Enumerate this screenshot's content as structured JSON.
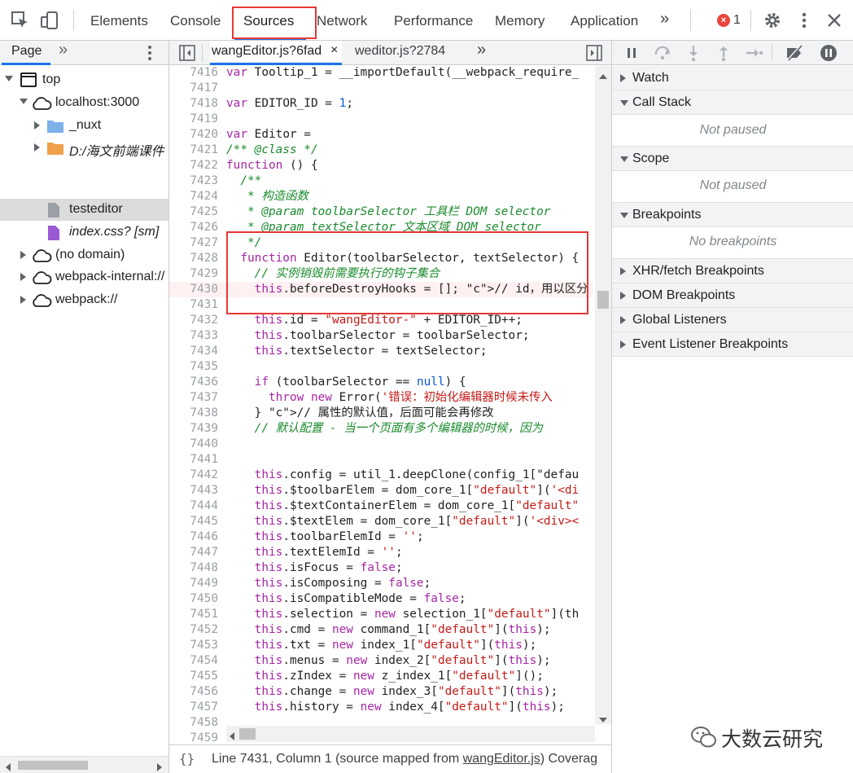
{
  "toolbar": {
    "tabs": [
      "Elements",
      "Console",
      "Sources",
      "Network",
      "Performance",
      "Memory",
      "Application"
    ],
    "active_tab": "Sources",
    "more": "»",
    "error_count": "1",
    "error_badge": "×"
  },
  "navigator": {
    "tab": "Page",
    "more": "»",
    "tree": [
      {
        "label": "top",
        "icon": "frame-icon",
        "arrow": "down"
      },
      {
        "label": "localhost:3000",
        "icon": "cloud-icon",
        "arrow": "down"
      },
      {
        "label": "_nuxt",
        "icon": "folder-icon",
        "arrow": "right"
      },
      {
        "label": "D:/海文前端课件",
        "icon": "folder-icon",
        "arrow": "right"
      },
      {
        "label": "testeditor",
        "icon": "file-icon",
        "arrow": "none"
      },
      {
        "label": "index.css? [sm]",
        "icon": "file-icon",
        "arrow": "none"
      },
      {
        "label": "(no domain)",
        "icon": "cloud-icon",
        "arrow": "right"
      },
      {
        "label": "webpack-internal://",
        "icon": "cloud-icon",
        "arrow": "right"
      },
      {
        "label": "webpack://",
        "icon": "cloud-icon",
        "arrow": "right"
      }
    ]
  },
  "editor": {
    "tabs": [
      {
        "label": "wangEditor.js?6fad",
        "close": "×"
      },
      {
        "label": "weditor.js?2784"
      }
    ],
    "more": "»",
    "lines": [
      {
        "n": "7416",
        "code": "var Tooltip_1 = __importDefault(__webpack_require_"
      },
      {
        "n": "7417",
        "code": ""
      },
      {
        "n": "7418",
        "code": "var EDITOR_ID = 1;"
      },
      {
        "n": "7419",
        "code": ""
      },
      {
        "n": "7420",
        "code": "var Editor ="
      },
      {
        "n": "7421",
        "code": "/** @class */"
      },
      {
        "n": "7422",
        "code": "function () {"
      },
      {
        "n": "7423",
        "code": "  /**"
      },
      {
        "n": "7424",
        "code": "   * 构造函数"
      },
      {
        "n": "7425",
        "code": "   * @param toolbarSelector 工具栏 DOM selector"
      },
      {
        "n": "7426",
        "code": "   * @param textSelector 文本区域 DOM selector"
      },
      {
        "n": "7427",
        "code": "   */"
      },
      {
        "n": "7428",
        "code": "  function Editor(toolbarSelector, textSelector) {"
      },
      {
        "n": "7429",
        "code": "    // 实例销毁前需要执行的钩子集合"
      },
      {
        "n": "7430",
        "code": "    this.beforeDestroyHooks = []; // id，用以区分"
      },
      {
        "n": "7431",
        "code": ""
      },
      {
        "n": "7432",
        "code": "    this.id = \"wangEditor-\" + EDITOR_ID++;"
      },
      {
        "n": "7433",
        "code": "    this.toolbarSelector = toolbarSelector;"
      },
      {
        "n": "7434",
        "code": "    this.textSelector = textSelector;"
      },
      {
        "n": "7435",
        "code": ""
      },
      {
        "n": "7436",
        "code": "    if (toolbarSelector == null) {"
      },
      {
        "n": "7437",
        "code": "      throw new Error('错误：初始化编辑器时候未传入"
      },
      {
        "n": "7438",
        "code": "    } // 属性的默认值，后面可能会再修改"
      },
      {
        "n": "7439",
        "code": "    // 默认配置 - 当一个页面有多个编辑器的时候，因为"
      },
      {
        "n": "7440",
        "code": ""
      },
      {
        "n": "7441",
        "code": ""
      },
      {
        "n": "7442",
        "code": "    this.config = util_1.deepClone(config_1[\"defau"
      },
      {
        "n": "7443",
        "code": "    this.$toolbarElem = dom_core_1[\"default\"]('<di"
      },
      {
        "n": "7444",
        "code": "    this.$textContainerElem = dom_core_1[\"default\""
      },
      {
        "n": "7445",
        "code": "    this.$textElem = dom_core_1[\"default\"]('<div><"
      },
      {
        "n": "7446",
        "code": "    this.toolbarElemId = '';"
      },
      {
        "n": "7447",
        "code": "    this.textElemId = '';"
      },
      {
        "n": "7448",
        "code": "    this.isFocus = false;"
      },
      {
        "n": "7449",
        "code": "    this.isComposing = false;"
      },
      {
        "n": "7450",
        "code": "    this.isCompatibleMode = false;"
      },
      {
        "n": "7451",
        "code": "    this.selection = new selection_1[\"default\"](th"
      },
      {
        "n": "7452",
        "code": "    this.cmd = new command_1[\"default\"](this);"
      },
      {
        "n": "7453",
        "code": "    this.txt = new index_1[\"default\"](this);"
      },
      {
        "n": "7454",
        "code": "    this.menus = new index_2[\"default\"](this);"
      },
      {
        "n": "7455",
        "code": "    this.zIndex = new z_index_1[\"default\"]();"
      },
      {
        "n": "7456",
        "code": "    this.change = new index_3[\"default\"](this);"
      },
      {
        "n": "7457",
        "code": "    this.history = new index_4[\"default\"](this);"
      },
      {
        "n": "7458",
        "code": ""
      },
      {
        "n": "7459",
        "code": ""
      }
    ]
  },
  "status": {
    "brace": "{}",
    "text_prefix": "Line 7431, Column 1  (source mapped from ",
    "link": "wangEditor.js",
    "text_suffix": ")  Coverag"
  },
  "debugger": {
    "panes": [
      {
        "label": "Watch",
        "arrow": "right"
      },
      {
        "label": "Call Stack",
        "arrow": "down",
        "message": "Not paused"
      },
      {
        "label": "Scope",
        "arrow": "down",
        "message": "Not paused"
      },
      {
        "label": "Breakpoints",
        "arrow": "down",
        "message": "No breakpoints"
      },
      {
        "label": "XHR/fetch Breakpoints",
        "arrow": "right"
      },
      {
        "label": "DOM Breakpoints",
        "arrow": "right"
      },
      {
        "label": "Global Listeners",
        "arrow": "right"
      },
      {
        "label": "Event Listener Breakpoints",
        "arrow": "right"
      }
    ]
  },
  "watermark": {
    "text": "大数云研究"
  },
  "colors": {
    "accent": "#1a73e8",
    "highlight": "#e53935",
    "error": "#e8453c"
  }
}
